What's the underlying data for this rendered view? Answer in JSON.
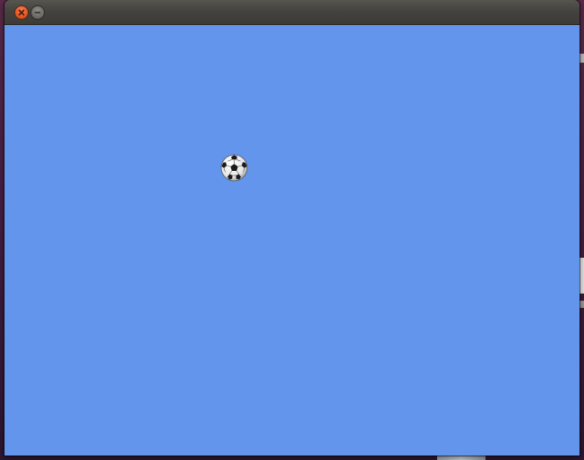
{
  "window": {
    "title": "",
    "buttons": [
      {
        "name": "close",
        "icon": "close-icon",
        "color": "#e85a23"
      },
      {
        "name": "minimize",
        "icon": "minimize-icon",
        "color": "#6e6c66"
      }
    ]
  },
  "canvas": {
    "background_color": "#6495ed",
    "sprite": {
      "icon": "soccer-ball-icon"
    }
  }
}
